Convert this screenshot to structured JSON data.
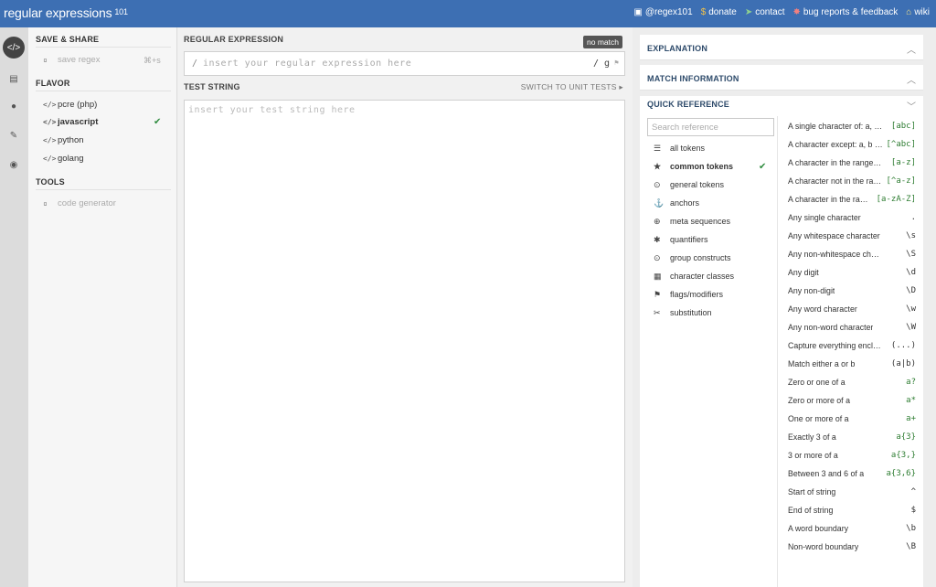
{
  "topbar": {
    "logo_main": "regular expressions",
    "logo_sup": "101",
    "links": [
      {
        "icon": "twitter-icon",
        "label": "@regex101"
      },
      {
        "icon": "dollar-icon",
        "label": "donate"
      },
      {
        "icon": "send-icon",
        "label": "contact"
      },
      {
        "icon": "bug-icon",
        "label": "bug reports & feedback"
      },
      {
        "icon": "bank-icon",
        "label": "wiki"
      }
    ],
    "color": "#3d6fb3"
  },
  "iconbar": [
    "code-icon",
    "book-icon",
    "user-icon",
    "wrench-icon",
    "chat-icon"
  ],
  "sidebar": {
    "save_share": "SAVE & SHARE",
    "save_regex": "save regex",
    "save_shortcut": "⌘+s",
    "flavor": "FLAVOR",
    "flavors": [
      "pcre (php)",
      "javascript",
      "python",
      "golang"
    ],
    "selected_flavor": "javascript",
    "tools": "TOOLS",
    "code_generator": "code generator"
  },
  "center": {
    "regex_label": "REGULAR EXPRESSION",
    "no_match": "no match",
    "regex_slash": "/",
    "regex_placeholder": "insert your regular expression here",
    "regex_flags": "/ g",
    "test_label": "TEST STRING",
    "unit_tests": "SWITCH TO UNIT TESTS ▸",
    "test_placeholder": "insert your test string here"
  },
  "right": {
    "explanation": "EXPLANATION",
    "match_info": "MATCH INFORMATION",
    "quick_ref": "QUICK REFERENCE",
    "search_placeholder": "Search reference",
    "categories": [
      {
        "icon": "database-icon",
        "label": "all tokens"
      },
      {
        "icon": "star-icon",
        "label": "common tokens"
      },
      {
        "icon": "circle-dot-icon",
        "label": "general tokens"
      },
      {
        "icon": "anchor-icon",
        "label": "anchors"
      },
      {
        "icon": "globe-icon",
        "label": "meta sequences"
      },
      {
        "icon": "asterisk-icon",
        "label": "quantifiers"
      },
      {
        "icon": "circle-dot-icon",
        "label": "group constructs"
      },
      {
        "icon": "grid-icon",
        "label": "character classes"
      },
      {
        "icon": "flag-icon",
        "label": "flags/modifiers"
      },
      {
        "icon": "scissors-icon",
        "label": "substitution"
      }
    ],
    "selected_category": "common tokens",
    "refs": [
      {
        "desc": "A single character of: a, b or c",
        "token": "[abc]"
      },
      {
        "desc": "A character except: a, b or c",
        "token": "[^abc]"
      },
      {
        "desc": "A character in the range: a-z",
        "token": "[a-z]"
      },
      {
        "desc": "A character not in the range: a-z",
        "token": "[^a-z]"
      },
      {
        "desc": "A character in the range: a-z or A-Z",
        "token": "[a-zA-Z]"
      },
      {
        "desc": "Any single character",
        "token": "."
      },
      {
        "desc": "Any whitespace character",
        "token": "\\s"
      },
      {
        "desc": "Any non-whitespace character",
        "token": "\\S"
      },
      {
        "desc": "Any digit",
        "token": "\\d"
      },
      {
        "desc": "Any non-digit",
        "token": "\\D"
      },
      {
        "desc": "Any word character",
        "token": "\\w"
      },
      {
        "desc": "Any non-word character",
        "token": "\\W"
      },
      {
        "desc": "Capture everything enclosed",
        "token": "(...)"
      },
      {
        "desc": "Match either a or b",
        "token": "(a|b)"
      },
      {
        "desc": "Zero or one of a",
        "token": "a?"
      },
      {
        "desc": "Zero or more of a",
        "token": "a*"
      },
      {
        "desc": "One or more of a",
        "token": "a+"
      },
      {
        "desc": "Exactly 3 of a",
        "token": "a{3}"
      },
      {
        "desc": "3 or more of a",
        "token": "a{3,}"
      },
      {
        "desc": "Between 3 and 6 of a",
        "token": "a{3,6}"
      },
      {
        "desc": "Start of string",
        "token": "^"
      },
      {
        "desc": "End of string",
        "token": "$"
      },
      {
        "desc": "A word boundary",
        "token": "\\b"
      },
      {
        "desc": "Non-word boundary",
        "token": "\\B"
      }
    ]
  }
}
